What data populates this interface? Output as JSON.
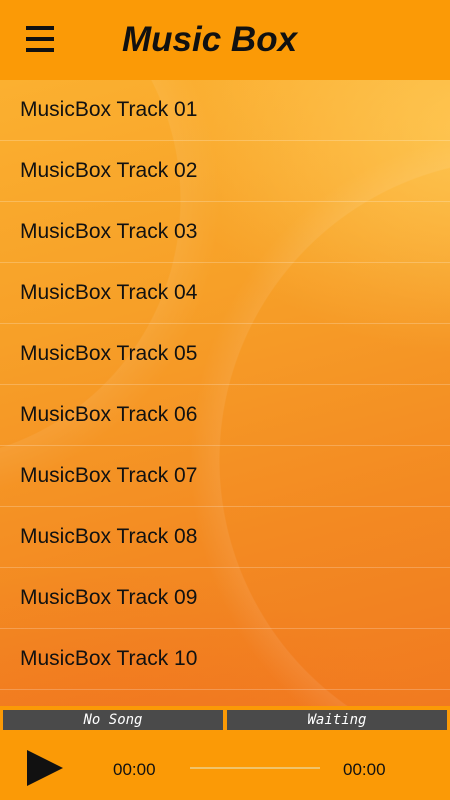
{
  "header": {
    "title": "Music Box",
    "menu_icon": "hamburger-menu-icon"
  },
  "tracks": [
    {
      "label": "MusicBox Track 01"
    },
    {
      "label": "MusicBox Track 02"
    },
    {
      "label": "MusicBox Track 03"
    },
    {
      "label": "MusicBox Track 04"
    },
    {
      "label": "MusicBox Track 05"
    },
    {
      "label": "MusicBox Track 06"
    },
    {
      "label": "MusicBox Track 07"
    },
    {
      "label": "MusicBox Track 08"
    },
    {
      "label": "MusicBox Track 09"
    },
    {
      "label": "MusicBox Track 10"
    }
  ],
  "player": {
    "song_status": "No Song",
    "player_status": "Waiting",
    "current_time": "00:00",
    "total_time": "00:00",
    "progress_fraction": 0,
    "play_icon": "play-icon"
  },
  "colors": {
    "accent": "#fb9a06",
    "status_bg": "#4a4a4a"
  }
}
